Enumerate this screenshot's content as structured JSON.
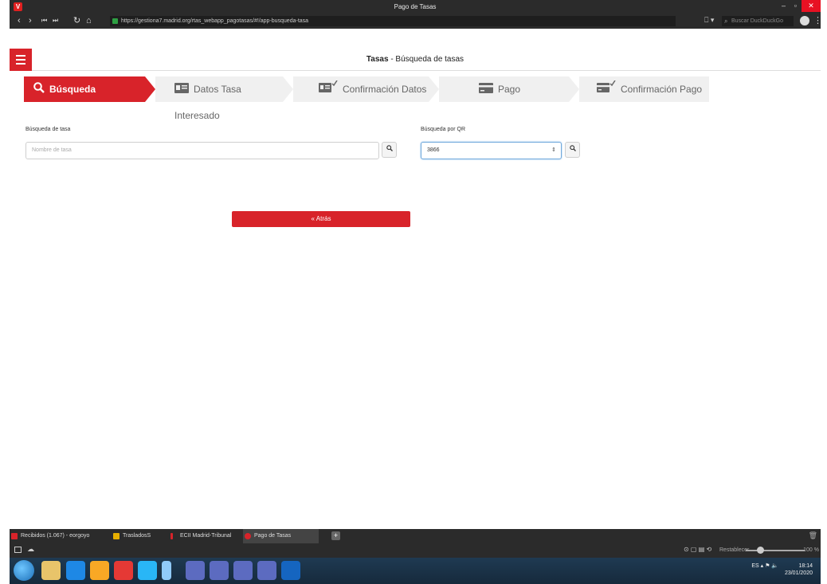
{
  "window": {
    "title": "Pago de Tasas",
    "minimize": "–",
    "maximize": "▫",
    "close": "✕"
  },
  "browser": {
    "url": "https://gestiona7.madrid.org/rtas_webapp_pagotasas/#!/app-busqueda-tasa",
    "search_placeholder": "Buscar DuckDuckGo"
  },
  "header": {
    "title_bold": "Tasas",
    "title_rest": " - Búsqueda de tasas"
  },
  "steps": [
    {
      "label": "Búsqueda",
      "icon": "search-icon",
      "active": true
    },
    {
      "label": "Datos Tasa Interesado",
      "icon": "id-card-icon",
      "active": false
    },
    {
      "label": "Confirmación Datos",
      "icon": "id-card-check-icon",
      "active": false
    },
    {
      "label": "Pago",
      "icon": "credit-card-icon",
      "active": false
    },
    {
      "label": "Confirmación Pago",
      "icon": "credit-card-check-icon",
      "active": false
    }
  ],
  "search": {
    "label": "Búsqueda de tasa",
    "placeholder": "Nombre de tasa"
  },
  "qr": {
    "label": "Búsqueda por QR",
    "value": "3866"
  },
  "back_button": "Atrás",
  "tabs": [
    {
      "label": "Recibidos (1.067) - eorgoyo",
      "color": "#d8232a"
    },
    {
      "label": "TrasladosS",
      "color": "#e8b000"
    },
    {
      "label": "ECII Madrid-Tribunal",
      "color": "#d8232a"
    },
    {
      "label": "Pago de Tasas",
      "color": "#d8232a"
    }
  ],
  "status": {
    "reset": "Restablecer",
    "zoom": "100 %"
  },
  "tray": {
    "lang": "ES",
    "time": "18:14",
    "date": "23/01/2020"
  }
}
